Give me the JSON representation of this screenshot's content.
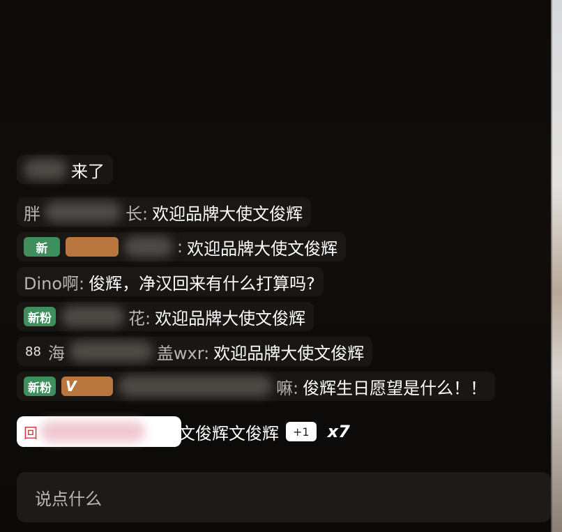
{
  "chat": {
    "join": {
      "suffix": "来了"
    },
    "messages": [
      {
        "name_visible": "胖",
        "name_tail": "长:",
        "text": "欢迎品牌大使文俊辉"
      },
      {
        "badge_fan": "新",
        "name_tail": ":",
        "text": "欢迎品牌大使文俊辉"
      },
      {
        "name": "Dino啊:",
        "text": "俊辉，净汉回来有什么打算吗?"
      },
      {
        "badge_fan": "新粉",
        "name_tail": "花:",
        "text": "欢迎品牌大使文俊辉"
      },
      {
        "badge_num": "88",
        "name_head": "海",
        "name_tail": "盖wxr:",
        "text": "欢迎品牌大使文俊辉"
      },
      {
        "badge_fan": "新粉",
        "badge_vip": "V",
        "name_tail": "嘛:",
        "text": "俊辉生日愿望是什么！！"
      }
    ],
    "highlight": {
      "icon": "回",
      "text": "文俊辉文俊辉",
      "plus": "+1",
      "combo": "x7"
    }
  },
  "input": {
    "placeholder": "说点什么"
  }
}
